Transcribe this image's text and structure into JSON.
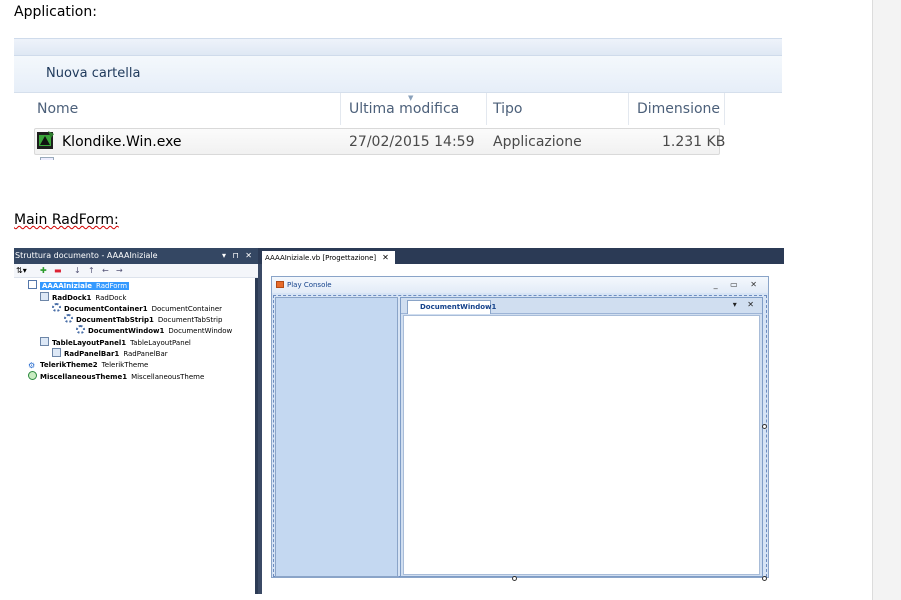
{
  "labels": {
    "application": "Application:",
    "main_radform": "Main RadForm:"
  },
  "explorer": {
    "toolbar": {
      "new_folder": "Nuova cartella"
    },
    "columns": [
      "Nome",
      "Ultima modifica",
      "Tipo",
      "Dimensione"
    ],
    "rows": [
      {
        "name": "Klondike.Win.exe",
        "modified": "27/02/2015 14:59",
        "type": "Applicazione",
        "size": "1.231 KB",
        "icon": "exe-icon"
      }
    ]
  },
  "vs": {
    "document_outline": {
      "title": "Struttura documento - AAAAIniziale",
      "title_controls": "▾ ⊓ ✕",
      "toolbar_icons": [
        "sort-icon",
        "add-icon",
        "remove-icon",
        "move-down-icon",
        "move-up-icon",
        "move-left-icon",
        "move-right-icon"
      ],
      "tree": [
        {
          "name": "AAAAIniziale",
          "type": "RadForm",
          "level": 0,
          "icon": "form-icon",
          "selected": true
        },
        {
          "name": "RadDock1",
          "type": "RadDock",
          "level": 1,
          "icon": "dock-icon"
        },
        {
          "name": "DocumentContainer1",
          "type": "DocumentContainer",
          "level": 2,
          "icon": "gear-icon"
        },
        {
          "name": "DocumentTabStrip1",
          "type": "DocumentTabStrip",
          "level": 3,
          "icon": "gear-icon"
        },
        {
          "name": "DocumentWindow1",
          "type": "DocumentWindow",
          "level": 4,
          "icon": "gear-icon"
        },
        {
          "name": "TableLayoutPanel1",
          "type": "TableLayoutPanel",
          "level": 1,
          "icon": "table-icon"
        },
        {
          "name": "RadPanelBar1",
          "type": "RadPanelBar",
          "level": 2,
          "icon": "panelbar-icon"
        },
        {
          "name": "TelerikTheme2",
          "type": "TelerikTheme",
          "level": 0,
          "icon": "telerik-theme-icon"
        },
        {
          "name": "MiscellaneousTheme1",
          "type": "MiscellaneousTheme",
          "level": 0,
          "icon": "misc-theme-icon"
        }
      ]
    },
    "editor_tab": {
      "label": "AAAAIniziale.vb [Progettazione]",
      "close": "✕"
    },
    "form": {
      "title": "Play Console",
      "controls": "_ ▭ ✕",
      "document_tab": "DocumentWindow1",
      "document_controls": "▾ ✕"
    }
  }
}
